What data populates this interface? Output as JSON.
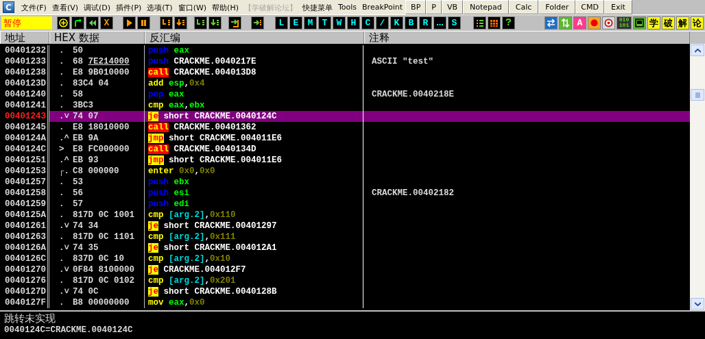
{
  "menu": {
    "logo": "C",
    "items": [
      {
        "label": "文件(F)",
        "disabled": false
      },
      {
        "label": "查看(V)",
        "disabled": false
      },
      {
        "label": "调试(D)",
        "disabled": false
      },
      {
        "label": "插件(P)",
        "disabled": false
      },
      {
        "label": "选项(T)",
        "disabled": false
      },
      {
        "label": "窗口(W)",
        "disabled": false
      },
      {
        "label": "帮助(H)",
        "disabled": false
      },
      {
        "label": "【学破解论坛】",
        "disabled": true
      },
      {
        "label": "快捷菜单",
        "disabled": false
      },
      {
        "label": "Tools",
        "disabled": false
      },
      {
        "label": "BreakPoint",
        "disabled": false
      }
    ],
    "buttons": [
      "BP",
      "P",
      "VB",
      "Notepad",
      "Calc",
      "Folder",
      "CMD",
      "Exit"
    ]
  },
  "toolbar": {
    "status": "暂停",
    "close_label": "X",
    "view_buttons": [
      "L",
      "E",
      "M",
      "T",
      "W",
      "H",
      "C",
      "/",
      "K",
      "B",
      "R"
    ],
    "view_buttons_2": [
      "S"
    ],
    "help_label": "?",
    "font_label": "A",
    "binary_label": "010 101",
    "forum_buttons": [
      "学",
      "破",
      "解",
      "论"
    ]
  },
  "columns": [
    "地址",
    "HEX 数据",
    "反汇编",
    "注释"
  ],
  "rows": [
    {
      "address": "00401232",
      "marker": ".",
      "bytes": "50",
      "selected": false,
      "instruction": [
        {
          "kind": "push",
          "text": "push"
        },
        {
          "kind": "reg",
          "text": "eax"
        }
      ]
    },
    {
      "address": "00401233",
      "marker": ".",
      "bytes": "68",
      "fixup": "7E214000",
      "selected": false,
      "instruction": [
        {
          "kind": "push",
          "text": "push"
        },
        {
          "kind": "sym",
          "text": "CRACKME.0040217E"
        }
      ],
      "comment": "ASCII \"test\""
    },
    {
      "address": "00401238",
      "marker": ".",
      "bytes": "E8 9B010000",
      "selected": false,
      "instruction": [
        {
          "kind": "call",
          "text": "call"
        },
        {
          "kind": "sym",
          "text": "CRACKME.004013D8"
        }
      ]
    },
    {
      "address": "0040123D",
      "marker": ".",
      "bytes": "83C4 04",
      "selected": false,
      "instruction": [
        {
          "kind": "op",
          "text": "add"
        },
        {
          "kind": "reg",
          "text": "esp"
        },
        {
          "kind": "punct",
          "text": ","
        },
        {
          "kind": "imm",
          "text": "0x4"
        }
      ]
    },
    {
      "address": "00401240",
      "marker": ".",
      "bytes": "58",
      "selected": false,
      "instruction": [
        {
          "kind": "push",
          "text": "pop"
        },
        {
          "kind": "reg",
          "text": "eax"
        }
      ],
      "comment": "CRACKME.0040218E"
    },
    {
      "address": "00401241",
      "marker": ".",
      "bytes": "3BC3",
      "selected": false,
      "instruction": [
        {
          "kind": "op",
          "text": "cmp"
        },
        {
          "kind": "reg",
          "text": "eax"
        },
        {
          "kind": "punct",
          "text": ","
        },
        {
          "kind": "reg",
          "text": "ebx"
        }
      ]
    },
    {
      "address": "00401243",
      "marker": ".˅",
      "bytes": "74 07",
      "selected": true,
      "instruction": [
        {
          "kind": "jump",
          "text": "je"
        },
        {
          "kind": "sym",
          "text": "short CRACKME.0040124C"
        }
      ]
    },
    {
      "address": "00401245",
      "marker": ".",
      "bytes": "E8 18010000",
      "selected": false,
      "instruction": [
        {
          "kind": "call",
          "text": "call"
        },
        {
          "kind": "sym",
          "text": "CRACKME.00401362"
        }
      ]
    },
    {
      "address": "0040124A",
      "marker": ".^",
      "bytes": "EB 9A",
      "selected": false,
      "instruction": [
        {
          "kind": "jump",
          "text": "jmp"
        },
        {
          "kind": "sym",
          "text": "short CRACKME.004011E6"
        }
      ]
    },
    {
      "address": "0040124C",
      "marker": ">",
      "bytes": "E8 FC000000",
      "selected": false,
      "instruction": [
        {
          "kind": "call",
          "text": "call"
        },
        {
          "kind": "sym",
          "text": "CRACKME.0040134D"
        }
      ]
    },
    {
      "address": "00401251",
      "marker": ".^",
      "bytes": "EB 93",
      "selected": false,
      "instruction": [
        {
          "kind": "jump",
          "text": "jmp"
        },
        {
          "kind": "sym",
          "text": "short CRACKME.004011E6"
        }
      ]
    },
    {
      "address": "00401253",
      "marker": "┌.",
      "bytes": "C8 000000",
      "selected": false,
      "instruction": [
        {
          "kind": "op",
          "text": "enter"
        },
        {
          "kind": "imm",
          "text": "0x0"
        },
        {
          "kind": "punct",
          "text": ","
        },
        {
          "kind": "imm",
          "text": "0x0"
        }
      ]
    },
    {
      "address": "00401257",
      "marker": ".",
      "bytes": "53",
      "selected": false,
      "instruction": [
        {
          "kind": "push",
          "text": "push"
        },
        {
          "kind": "reg",
          "text": "ebx"
        }
      ]
    },
    {
      "address": "00401258",
      "marker": ".",
      "bytes": "56",
      "selected": false,
      "instruction": [
        {
          "kind": "push",
          "text": "push"
        },
        {
          "kind": "reg",
          "text": "esi"
        }
      ],
      "comment": "CRACKME.00402182"
    },
    {
      "address": "00401259",
      "marker": ".",
      "bytes": "57",
      "selected": false,
      "instruction": [
        {
          "kind": "push",
          "text": "push"
        },
        {
          "kind": "reg",
          "text": "edi"
        }
      ]
    },
    {
      "address": "0040125A",
      "marker": ".",
      "bytes": "817D 0C 1001",
      "selected": false,
      "instruction": [
        {
          "kind": "op",
          "text": "cmp"
        },
        {
          "kind": "arg",
          "text": "[arg.2]"
        },
        {
          "kind": "punct",
          "text": ","
        },
        {
          "kind": "imm",
          "text": "0x110"
        }
      ]
    },
    {
      "address": "00401261",
      "marker": ".˅",
      "bytes": "74 34",
      "selected": false,
      "instruction": [
        {
          "kind": "jump",
          "text": "je"
        },
        {
          "kind": "sym",
          "text": "short CRACKME.00401297"
        }
      ]
    },
    {
      "address": "00401263",
      "marker": ".",
      "bytes": "817D 0C 1101",
      "selected": false,
      "instruction": [
        {
          "kind": "op",
          "text": "cmp"
        },
        {
          "kind": "arg",
          "text": "[arg.2]"
        },
        {
          "kind": "punct",
          "text": ","
        },
        {
          "kind": "imm",
          "text": "0x111"
        }
      ]
    },
    {
      "address": "0040126A",
      "marker": ".˅",
      "bytes": "74 35",
      "selected": false,
      "instruction": [
        {
          "kind": "jump",
          "text": "je"
        },
        {
          "kind": "sym",
          "text": "short CRACKME.004012A1"
        }
      ]
    },
    {
      "address": "0040126C",
      "marker": ".",
      "bytes": "837D 0C 10",
      "selected": false,
      "instruction": [
        {
          "kind": "op",
          "text": "cmp"
        },
        {
          "kind": "arg",
          "text": "[arg.2]"
        },
        {
          "kind": "punct",
          "text": ","
        },
        {
          "kind": "imm",
          "text": "0x10"
        }
      ]
    },
    {
      "address": "00401270",
      "marker": ".˅",
      "bytes": "0F84 8100000",
      "selected": false,
      "instruction": [
        {
          "kind": "jump",
          "text": "je"
        },
        {
          "kind": "sym",
          "text": "CRACKME.004012F7"
        }
      ]
    },
    {
      "address": "00401276",
      "marker": ".",
      "bytes": "817D 0C 0102",
      "selected": false,
      "instruction": [
        {
          "kind": "op",
          "text": "cmp"
        },
        {
          "kind": "arg",
          "text": "[arg.2]"
        },
        {
          "kind": "punct",
          "text": ","
        },
        {
          "kind": "imm",
          "text": "0x201"
        }
      ]
    },
    {
      "address": "0040127D",
      "marker": ".˅",
      "bytes": "74 0C",
      "selected": false,
      "instruction": [
        {
          "kind": "jump",
          "text": "je"
        },
        {
          "kind": "sym",
          "text": "short CRACKME.0040128B"
        }
      ]
    },
    {
      "address": "0040127F",
      "marker": ".",
      "bytes": "B8 00000000",
      "selected": false,
      "instruction": [
        {
          "kind": "op",
          "text": "mov"
        },
        {
          "kind": "reg",
          "text": "eax"
        },
        {
          "kind": "punct",
          "text": ","
        },
        {
          "kind": "imm",
          "text": "0x0"
        }
      ]
    }
  ],
  "info": [
    "跳转未实现",
    "0040124C=CRACKME.0040124C"
  ]
}
